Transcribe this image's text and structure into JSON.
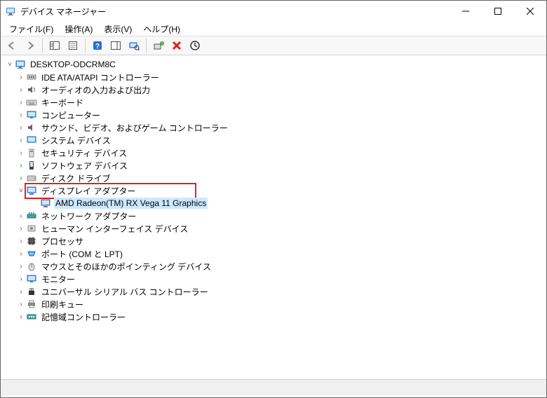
{
  "window": {
    "title": "デバイス マネージャー"
  },
  "menu": {
    "file": "ファイル(F)",
    "action": "操作(A)",
    "view": "表示(V)",
    "help": "ヘルプ(H)"
  },
  "tree": {
    "root": "DESKTOP-ODCRM8C",
    "items": [
      {
        "label": "IDE ATA/ATAPI コントローラー"
      },
      {
        "label": "オーディオの入力および出力"
      },
      {
        "label": "キーボード"
      },
      {
        "label": "コンピューター"
      },
      {
        "label": "サウンド、ビデオ、およびゲーム コントローラー"
      },
      {
        "label": "システム デバイス"
      },
      {
        "label": "セキュリティ デバイス"
      },
      {
        "label": "ソフトウェア デバイス"
      },
      {
        "label": "ディスク ドライブ"
      },
      {
        "label": "ディスプレイ アダプター"
      },
      {
        "label": "ネットワーク アダプター"
      },
      {
        "label": "ヒューマン インターフェイス デバイス"
      },
      {
        "label": "プロセッサ"
      },
      {
        "label": "ポート (COM と LPT)"
      },
      {
        "label": "マウスとそのほかのポインティング デバイス"
      },
      {
        "label": "モニター"
      },
      {
        "label": "ユニバーサル シリアル バス コントローラー"
      },
      {
        "label": "印刷キュー"
      },
      {
        "label": "記憶域コントローラー"
      }
    ],
    "display_child": "AMD Radeon(TM) RX Vega 11 Graphics"
  }
}
